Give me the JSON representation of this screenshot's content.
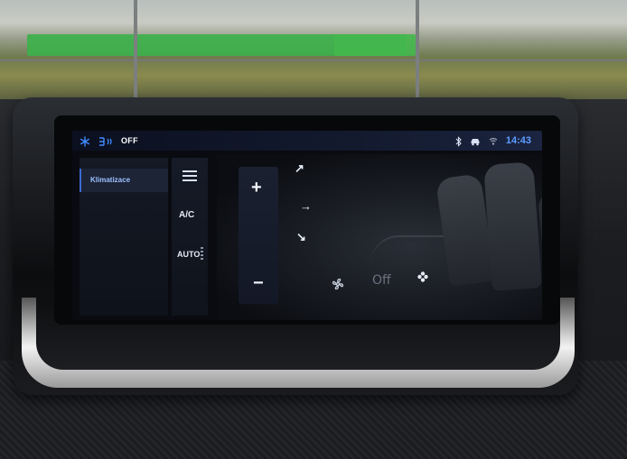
{
  "status_bar": {
    "off_label": "OFF",
    "time": "14:43",
    "icons": [
      "snowflake-icon",
      "rear-defrost-icon",
      "bluetooth-icon",
      "car-icon",
      "signal-icon"
    ]
  },
  "menu": {
    "active_item": "Klimatizace"
  },
  "controls": {
    "ac_label": "A/C",
    "auto_label": "AUTO",
    "plus_label": "+",
    "minus_label": "−",
    "fan_off_label": "Off"
  },
  "colors": {
    "accent": "#3a6bd1",
    "time_color": "#5b9dff",
    "fence_green": "#3bb14a"
  }
}
